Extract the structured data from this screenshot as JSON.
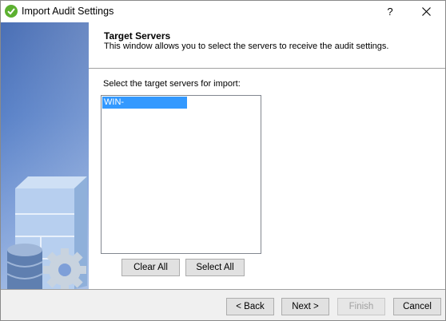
{
  "window": {
    "title": "Import Audit Settings",
    "help_label": "?"
  },
  "header": {
    "title": "Target Servers",
    "description": "This window allows you to select the servers to receive the audit settings."
  },
  "content": {
    "prompt": "Select the target servers for import:",
    "servers": [
      {
        "name": "WIN-",
        "selected": true
      }
    ],
    "clear_all_label": "Clear All",
    "select_all_label": "Select All"
  },
  "footer": {
    "back_label": "< Back",
    "next_label": "Next >",
    "finish_label": "Finish",
    "finish_enabled": false,
    "cancel_label": "Cancel"
  },
  "colors": {
    "selection": "#3399ff",
    "app_icon": "#5cb030",
    "sidebar_top": "#4a6fb5",
    "sidebar_bottom": "#9cb7e3"
  },
  "icons": {
    "app": "check-circle-icon",
    "close": "close-icon",
    "banner": "server-database-gear-illustration"
  }
}
